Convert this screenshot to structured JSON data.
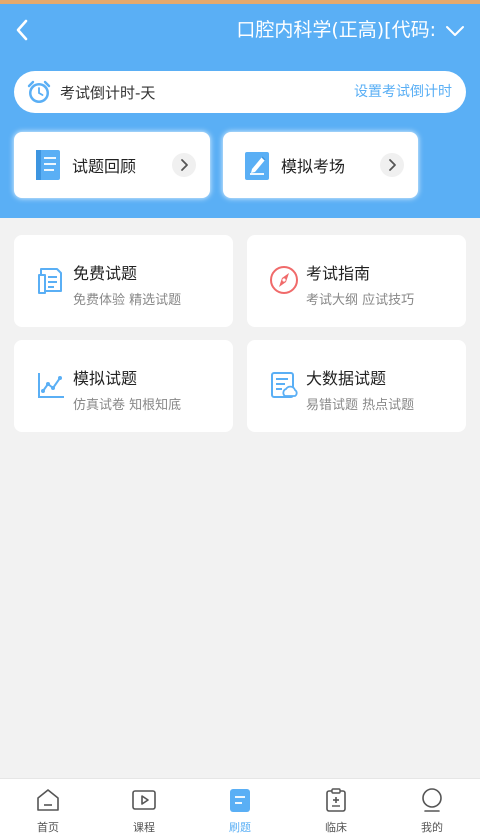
{
  "header": {
    "title": "口腔内科学(正高)[代码:"
  },
  "countdown": {
    "text": "考试倒计时-天",
    "link": "设置考试倒计时"
  },
  "quick_actions": [
    {
      "label": "试题回顾",
      "icon": "book-icon"
    },
    {
      "label": "模拟考场",
      "icon": "pencil-paper-icon"
    }
  ],
  "cards": [
    {
      "title": "免费试题",
      "subtitle": "免费体验 精选试题",
      "icon": "document-icon"
    },
    {
      "title": "考试指南",
      "subtitle": "考试大纲 应试技巧",
      "icon": "compass-icon"
    },
    {
      "title": "模拟试题",
      "subtitle": "仿真试卷 知根知底",
      "icon": "line-chart-icon"
    },
    {
      "title": "大数据试题",
      "subtitle": "易错试题 热点试题",
      "icon": "data-report-icon"
    }
  ],
  "tabs": [
    {
      "label": "首页",
      "icon": "home-icon"
    },
    {
      "label": "课程",
      "icon": "video-play-icon"
    },
    {
      "label": "刷题",
      "icon": "practice-icon",
      "active": true
    },
    {
      "label": "临床",
      "icon": "clipboard-icon"
    },
    {
      "label": "我的",
      "icon": "user-icon"
    }
  ],
  "colors": {
    "primary": "#5aaff5",
    "background": "#f2f2f2",
    "compass_red": "#f06a6a"
  }
}
